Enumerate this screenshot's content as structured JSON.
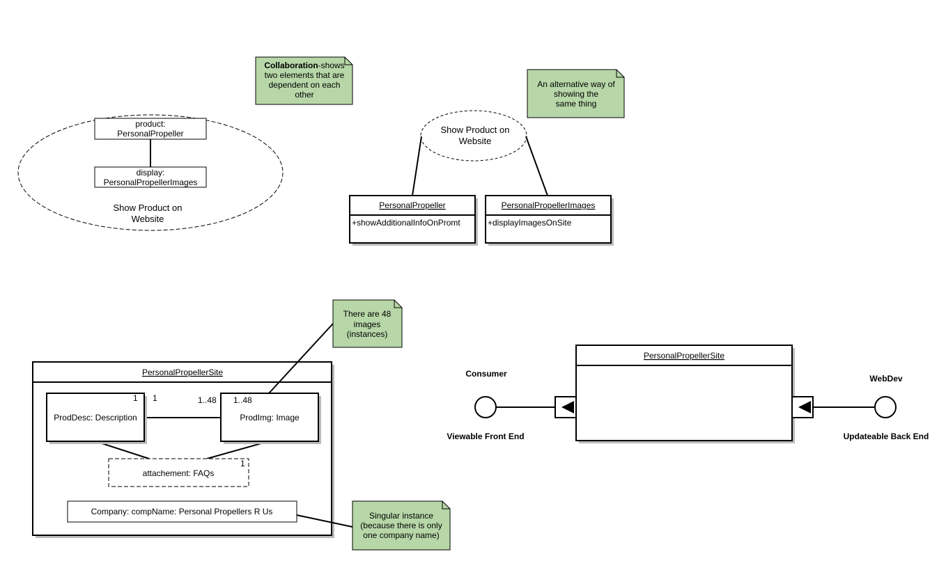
{
  "notes": {
    "collaboration": {
      "bold": "Collaboration",
      "line1_rest": "-shows",
      "line2": "two elements that are",
      "line3": "dependent on each",
      "line4": "other"
    },
    "alternative": {
      "line1": "An alternative way of",
      "line2": "showing the",
      "line3": "same thing"
    },
    "images": {
      "line1": "There are 48",
      "line2": "images",
      "line3": "(instances)"
    },
    "singular": {
      "line1": "Singular instance",
      "line2": "(because there is only",
      "line3": "one company name)"
    }
  },
  "collaboration_ellipse": {
    "product_box": {
      "line1": "product:",
      "line2": "PersonalPropeller"
    },
    "display_box": {
      "line1": "display:",
      "line2": "PersonalPropellerImages"
    },
    "label_line1": "Show Product on",
    "label_line2": "Website"
  },
  "alt_collaboration": {
    "label_line1": "Show Product on",
    "label_line2": "Website",
    "class_left": {
      "name": "PersonalPropeller",
      "operation": "+showAdditionalInfoOnPromt"
    },
    "class_right": {
      "name": "PersonalPropellerImages",
      "operation": "+displayImagesOnSite"
    }
  },
  "composite": {
    "title": "PersonalPropellerSite",
    "prod_desc": {
      "label": "ProdDesc: Description",
      "multiplicity": "1"
    },
    "prod_img": {
      "label": "ProdImg: Image",
      "multiplicity": "1..48"
    },
    "assoc_end_desc": "1",
    "assoc_end_img": "1..48",
    "faqs": {
      "label": "attachement: FAQs",
      "multiplicity": "1"
    },
    "company": {
      "label": "Company: compName: Personal Propellers R Us"
    }
  },
  "component": {
    "title": "PersonalPropellerSite",
    "left_actor": "Consumer",
    "left_interface": "Viewable Front End",
    "right_actor": "WebDev",
    "right_interface": "Updateable Back End"
  },
  "colors": {
    "note_fill": "#b7d7a8"
  }
}
